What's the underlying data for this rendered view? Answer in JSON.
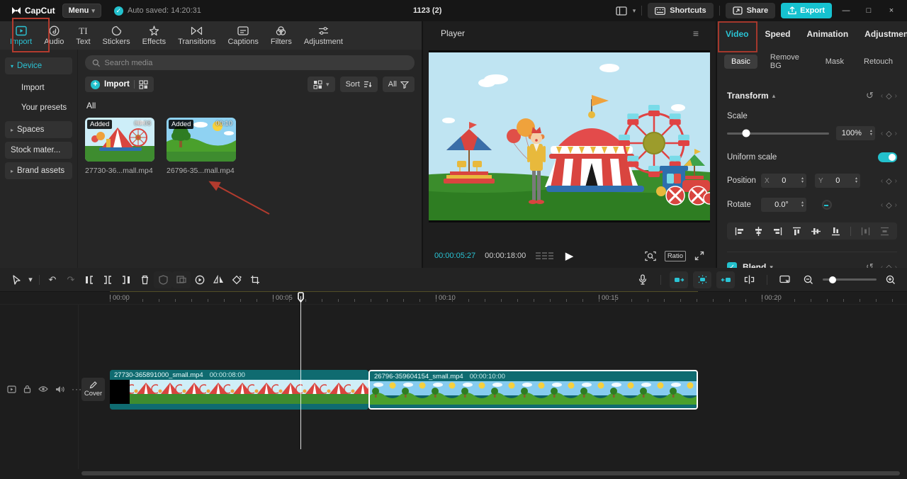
{
  "colors": {
    "accent": "#23c1cd",
    "annotation": "#b23b2e",
    "clip_teal": "#0f6b70",
    "export_bg": "#16c2d0"
  },
  "icons": {
    "caret_down": "▾",
    "caret_right": "▸",
    "caret_up": "▴",
    "check": "✓",
    "plus": "+",
    "play": "▶",
    "hamburger": "≡",
    "undo": "↶",
    "redo": "↷",
    "reset": "↺",
    "kf_prev": "‹",
    "kf_diamond": "◇",
    "kf_next": "›",
    "minimize": "—",
    "maximize": "□",
    "close": "×",
    "dots_h": "···",
    "stepper_up": "▴",
    "stepper_down": "▾",
    "text_tab_glyph": "TI"
  },
  "titlebar": {
    "app_name": "CapCut",
    "menu_label": "Menu",
    "autosave_text": "Auto saved: 14:20:31",
    "doc_title": "1123 (2)",
    "shortcuts_label": "Shortcuts",
    "share_label": "Share",
    "export_label": "Export"
  },
  "media_tabbar": {
    "tabs": [
      {
        "label": "Import"
      },
      {
        "label": "Audio"
      },
      {
        "label": "Text"
      },
      {
        "label": "Stickers"
      },
      {
        "label": "Effects"
      },
      {
        "label": "Transitions"
      },
      {
        "label": "Captions"
      },
      {
        "label": "Filters"
      },
      {
        "label": "Adjustment"
      }
    ]
  },
  "sidebar": {
    "items": [
      {
        "label": "Device"
      },
      {
        "label": "Import"
      },
      {
        "label": "Your presets"
      },
      {
        "label": "Spaces"
      },
      {
        "label": "Stock mater..."
      },
      {
        "label": "Brand assets"
      }
    ]
  },
  "media_panel": {
    "search_placeholder": "Search media",
    "import_label": "Import",
    "sort_label": "Sort",
    "filter_label": "All",
    "section_label": "All",
    "items": [
      {
        "badge": "Added",
        "duration": "00:08",
        "name": "27730-36...mall.mp4"
      },
      {
        "badge": "Added",
        "duration": "00:10",
        "name": "26796-35...mall.mp4"
      }
    ]
  },
  "player": {
    "title": "Player",
    "current_time": "00:00:05:27",
    "total_time": "00:00:18:00",
    "ratio_label": "Ratio"
  },
  "inspector": {
    "tabs": [
      "Video",
      "Speed",
      "Animation",
      "Adjustment"
    ],
    "subtabs": [
      "Basic",
      "Remove BG",
      "Mask",
      "Retouch"
    ],
    "transform_label": "Transform",
    "scale_label": "Scale",
    "scale_value": "100%",
    "uniform_scale_label": "Uniform scale",
    "uniform_scale_on": true,
    "position_label": "Position",
    "position_x_label": "X",
    "position_x_value": "0",
    "position_y_label": "Y",
    "position_y_value": "0",
    "rotate_label": "Rotate",
    "rotate_value": "0.0°",
    "blend_label": "Blend"
  },
  "timeline": {
    "ruler_labels": [
      "00:00",
      "00:05",
      "00:10",
      "00:15",
      "00:20"
    ],
    "cover_label": "Cover",
    "clips": [
      {
        "name": "27730-365891000_small.mp4",
        "duration": "00:00:08:00"
      },
      {
        "name": "26796-359604154_small.mp4",
        "duration": "00:00:10:00"
      }
    ]
  }
}
